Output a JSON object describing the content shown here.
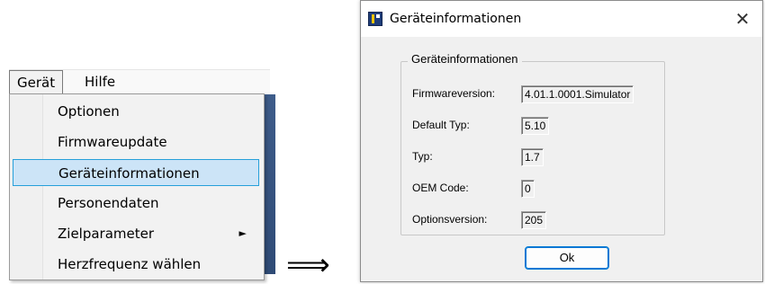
{
  "menubar": {
    "items": [
      {
        "label": "Gerät"
      },
      {
        "label": "Hilfe"
      }
    ]
  },
  "dropdown": {
    "items": [
      {
        "label": "Optionen"
      },
      {
        "label": "Firmwareupdate"
      },
      {
        "label": "Geräteinformationen",
        "selected": true
      },
      {
        "label": "Personendaten"
      },
      {
        "label": "Zielparameter",
        "submenu": true
      },
      {
        "label": "Herzfrequenz wählen"
      }
    ],
    "submenu_glyph": "►"
  },
  "arrow": {
    "glyph": "⟹"
  },
  "dialog": {
    "title": "Geräteinformationen",
    "close_glyph": "✕",
    "group_title": "Geräteinformationen",
    "rows": [
      {
        "label": "Firmwareversion:",
        "value": "4.01.1.0001.Simulator"
      },
      {
        "label": "Default Typ:",
        "value": "5.10"
      },
      {
        "label": "Typ:",
        "value": "1.7"
      },
      {
        "label": "OEM Code:",
        "value": "0"
      },
      {
        "label": "Optionsversion:",
        "value": "205"
      }
    ],
    "ok_label": "Ok"
  },
  "colors": {
    "selection_fill": "#cce4f7",
    "selection_border": "#26a0da",
    "dialog_bg": "#f0f0f0",
    "ok_border": "#0078d4"
  },
  "icons": [
    "app-icon",
    "close-icon",
    "submenu-arrow-icon",
    "implies-arrow-icon"
  ]
}
